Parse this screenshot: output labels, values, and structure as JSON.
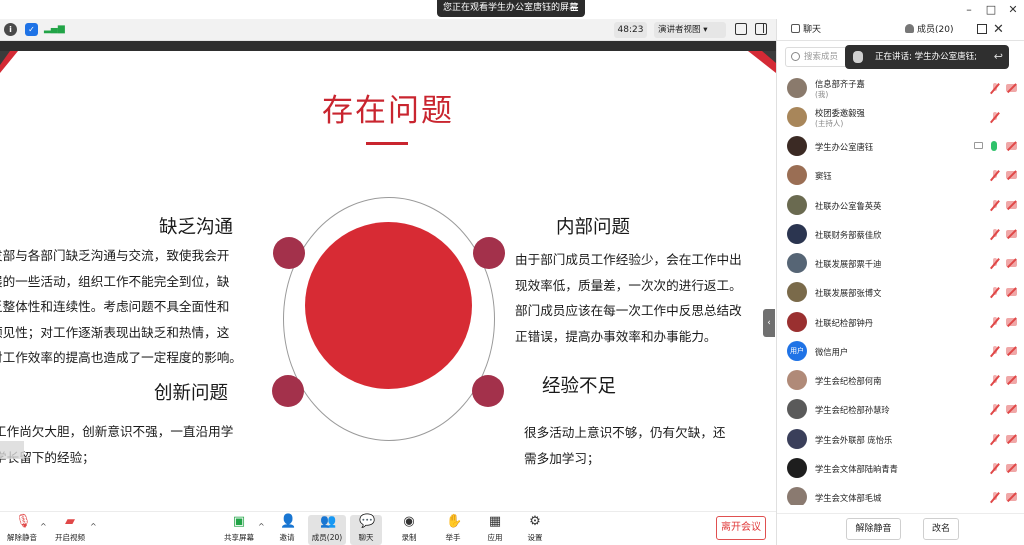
{
  "window": {
    "share_banner": "您正在观看学生办公室唐钰的屏幕",
    "menu_glyph": "☰",
    "minimize": "–",
    "maximize": "□",
    "close": "✕"
  },
  "meeting_toolbar": {
    "timer": "48:23",
    "view_mode": "演讲者视图 ▾"
  },
  "slide": {
    "title": "存在问题",
    "sections": [
      {
        "heading": "缺乏沟通",
        "lines": [
          "发部与各部门缺乏沟通与交流，致使我会开",
          "展的一些活动，组织工作不能完全到位，缺",
          "乏整体性和连续性。考虑问题不具全面性和",
          "预见性；对工作逐渐表现出缺乏和热情，这",
          "对工作效率的提高也造成了一定程度的影响。"
        ]
      },
      {
        "heading": "内部问题",
        "lines": [
          "由于部门成员工作经验少，会在工作中出",
          "现效率低，质量差，一次次的进行返工。",
          "部门成员应该在每一次工作中反思总结改",
          "正错误，提高办事效率和办事能力。"
        ]
      },
      {
        "heading": "创新问题",
        "lines": [
          "工作尚欠大胆，创新意识不强，一直沿用学",
          "学长留下的经验；"
        ]
      },
      {
        "heading": "经验不足",
        "lines": [
          "很多活动上意识不够，仍有欠缺，还",
          "需多加学习；"
        ]
      }
    ]
  },
  "bottom_bar": {
    "unmute": "解除静音",
    "start_video": "开启视频",
    "share_screen": "共享屏幕",
    "invite": "邀请",
    "members": "成员(20)",
    "chat": "聊天",
    "record": "录制",
    "raise_hand": "举手",
    "apps": "应用",
    "settings": "设置",
    "leave": "离开会议"
  },
  "panel": {
    "tab_chat": "聊天",
    "tab_members": "成员(20)",
    "search_placeholder": "搜索成员",
    "speaking": "正在讲话: 学生办公室唐钰;",
    "back_glyph": "↩",
    "members": [
      {
        "name": "信息部齐子嘉",
        "role": "(我)",
        "avatar": "",
        "mic": "off",
        "cam": "off"
      },
      {
        "name": "校团委邀毅强",
        "role": "(主持人)",
        "avatar": "",
        "mic": "off",
        "cam": "none"
      },
      {
        "name": "学生办公室唐钰",
        "role": "",
        "avatar": "",
        "mic": "on",
        "cam": "off",
        "sharing": true
      },
      {
        "name": "窦钰",
        "role": "",
        "avatar": "",
        "mic": "off",
        "cam": "off"
      },
      {
        "name": "社联办公室鲁英英",
        "role": "",
        "avatar": "",
        "mic": "off",
        "cam": "off"
      },
      {
        "name": "社联财务部蔡佳欣",
        "role": "",
        "avatar": "",
        "mic": "off",
        "cam": "off"
      },
      {
        "name": "社联发展部票千迪",
        "role": "",
        "avatar": "",
        "mic": "off",
        "cam": "off"
      },
      {
        "name": "社联发展部张博文",
        "role": "",
        "avatar": "",
        "mic": "off",
        "cam": "off"
      },
      {
        "name": "社联纪检部钟丹",
        "role": "",
        "avatar": "",
        "mic": "off",
        "cam": "off"
      },
      {
        "name": "微信用户",
        "role": "",
        "avatar": "用户",
        "mic": "off",
        "cam": "off"
      },
      {
        "name": "学生会纪检部何南",
        "role": "",
        "avatar": "",
        "mic": "off",
        "cam": "off"
      },
      {
        "name": "学生会纪检部孙慧玲",
        "role": "",
        "avatar": "",
        "mic": "off",
        "cam": "off"
      },
      {
        "name": "学生会外联部 庞怡乐",
        "role": "",
        "avatar": "",
        "mic": "off",
        "cam": "off"
      },
      {
        "name": "学生会文体部陆晌青青",
        "role": "",
        "avatar": "",
        "mic": "off",
        "cam": "off"
      },
      {
        "name": "学生会文体部毛城",
        "role": "",
        "avatar": "",
        "mic": "off",
        "cam": "off"
      }
    ],
    "unmute_all": "解除静音",
    "rename": "改名"
  },
  "colors": {
    "accent_red": "#d72b34",
    "title_red": "#c9252f",
    "bubble": "#a3314b",
    "avatar_blue": "#1f73e6"
  }
}
